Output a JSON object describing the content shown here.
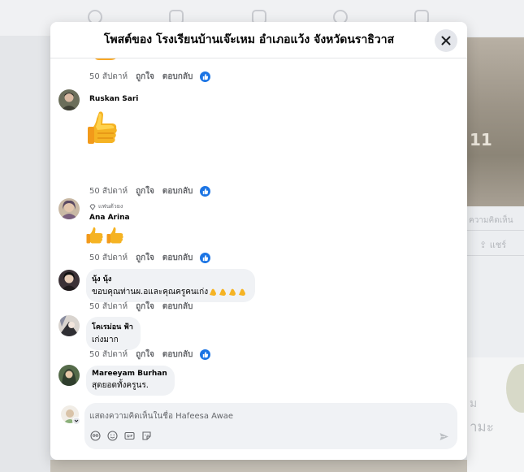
{
  "modal": {
    "title": "โพสต์ของ โรงเรียนบ้านเจ๊ะเหม อำเภอแว้ง จังหวัดนราธิวาส"
  },
  "actions": {
    "time": "50 สัปดาห์",
    "like": "ถูกใจ",
    "reply": "ตอบกลับ"
  },
  "comments": [
    {
      "name": "Ruskan Sari",
      "text": "",
      "sticker": "thumbs-up-large"
    },
    {
      "badge": "แฟนตัวยง",
      "name": "Ana Arina",
      "text": "",
      "sticker": "two-thumbs-up"
    },
    {
      "name": "นุ้ง นุ้ง",
      "text": "ขอบคุณท่านผ.อและคุณครูคนเก่ง"
    },
    {
      "name": "โคเรม่อน ฟ้า",
      "text": "เก่งมาก"
    },
    {
      "name": "Mareeyam Burhan",
      "text": "สุดยอดทั้งครูนร."
    }
  ],
  "composer": {
    "placeholder": "แสดงความคิดเห็นในชื่อ Hafeesa Awae"
  },
  "colors": {
    "accent": "#1b74e4",
    "bubble": "#f0f2f5",
    "muted_text": "#65676b"
  },
  "background": {
    "photo_number": "11",
    "comment_hint": "ความคิดเห็น",
    "share_label": "แชร์",
    "card_text_1": "ม",
    "card_text_2": "ามะ"
  }
}
